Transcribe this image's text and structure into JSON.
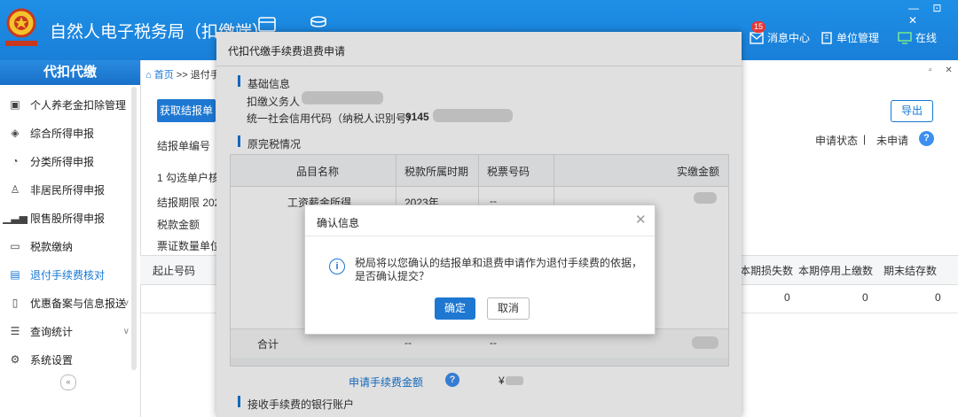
{
  "header": {
    "app_title": "自然人电子税务局（扣缴端）",
    "message_center": "消息中心",
    "message_count": "15",
    "unit_management": "单位管理",
    "online": "在线",
    "window_controls": "— ⊡ ✕"
  },
  "sidebar": {
    "title": "代扣代缴",
    "items": [
      {
        "label": "个人养老金扣除管理",
        "icon": "pension-icon"
      },
      {
        "label": "综合所得申报",
        "icon": "layers-icon"
      },
      {
        "label": "分类所得申报",
        "icon": "pie-icon"
      },
      {
        "label": "非居民所得申报",
        "icon": "user-icon"
      },
      {
        "label": "限售股所得申报",
        "icon": "bar-chart-icon"
      },
      {
        "label": "税款缴纳",
        "icon": "folder-icon"
      },
      {
        "label": "退付手续费核对",
        "icon": "document-icon"
      },
      {
        "label": "优惠备案与信息报送",
        "icon": "file-icon"
      },
      {
        "label": "查询统计",
        "icon": "list-icon"
      },
      {
        "label": "系统设置",
        "icon": "gear-icon"
      }
    ],
    "collapse": "«"
  },
  "breadcrumb": {
    "home": "首页",
    "sep": ">>",
    "current": "退付手"
  },
  "tab_close": "▫ ✕",
  "content": {
    "get_report_button": "获取结报单",
    "export_button": "导出",
    "status_label": "申请状态",
    "status_sep": "|",
    "status_value": "未申请",
    "report_no_label": "结报单编号",
    "step1_label": "1 勾选单户核",
    "report_period_label": "结报期限  202",
    "tax_amount_label": "税款金额",
    "ticket_count_label": "票证数量单位",
    "table_headers": [
      "起止号码",
      "本期损失数",
      "本期停用上缴数",
      "期末结存数"
    ],
    "table_row": [
      "0",
      "0",
      "0"
    ]
  },
  "dialog": {
    "title": "代扣代缴手续费退费申请",
    "basic_info_title": "基础信息",
    "withholding_agent_label": "扣缴义务人",
    "credit_code_label": "统一社会信用代码（纳税人识别号）",
    "credit_code_value": "9145",
    "tax_status_title": "原完税情况",
    "table_headers": [
      "品目名称",
      "税款所属时期",
      "税票号码",
      "实缴金额"
    ],
    "table_row": [
      "工资薪金所得",
      "2023年",
      "--"
    ],
    "sum_row": [
      "合计",
      "--",
      "--"
    ],
    "fee_label": "申请手续费金额",
    "fee_value": "¥",
    "bank_account_title": "接收手续费的银行账户"
  },
  "confirm": {
    "title": "确认信息",
    "close": "✕",
    "message": "税局将以您确认的结报单和退费申请作为退付手续费的依据，是否确认提交？",
    "ok": "确定",
    "cancel": "取消"
  },
  "colors": {
    "header_blue": "#1a7fd8",
    "accent": "#1677d6"
  }
}
